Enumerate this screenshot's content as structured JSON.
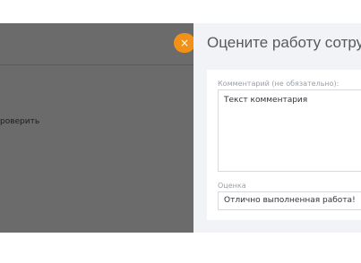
{
  "overlay": {
    "text_fragment": "роверить"
  },
  "close_button": {
    "icon": "close-icon",
    "glyph": "×",
    "color": "#f29118"
  },
  "panel": {
    "title": "Оцените работу сотруд",
    "comment": {
      "label": "Комментарий (не обязательно):",
      "value": "Текст комментария"
    },
    "rating": {
      "label": "Оценка",
      "value": "Отлично выполненная работа!"
    }
  }
}
